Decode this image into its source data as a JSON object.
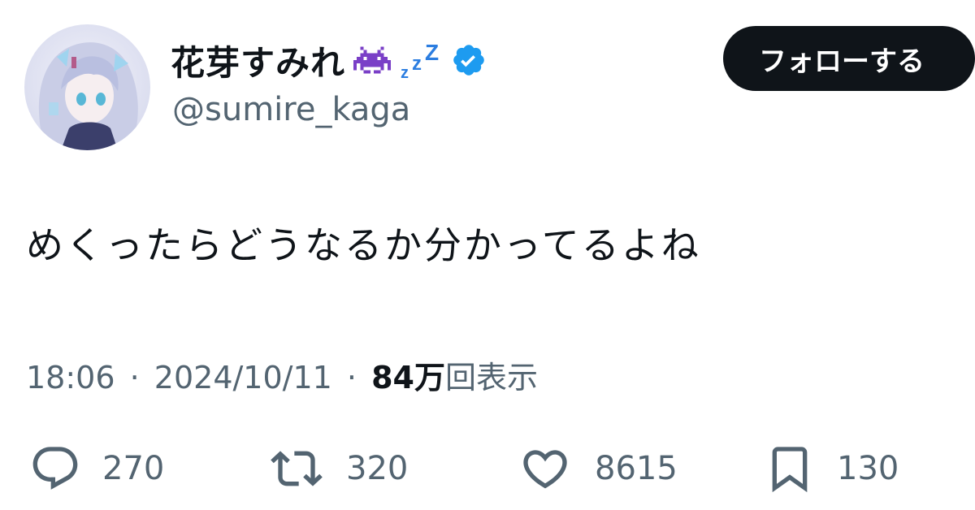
{
  "author": {
    "display_name": "花芽すみれ",
    "handle": "@sumire_kaga",
    "verified": true,
    "name_emoji": [
      "purple-space-invader-icon",
      "zzz-sleep-icon"
    ],
    "verified_color": "#1d9bf0"
  },
  "follow_button": {
    "label": "フォローする"
  },
  "tweet": {
    "text": "めくったらどうなるか分かってるよね"
  },
  "meta": {
    "time": "18:06",
    "separator": "·",
    "date": "2024/10/11",
    "views_count": "84万",
    "views_label": "回表示"
  },
  "actions": {
    "replies": "270",
    "retweets": "320",
    "likes": "8615",
    "bookmarks": "130"
  },
  "colors": {
    "text_primary": "#0f1419",
    "text_secondary": "#536471",
    "button_bg": "#0f1419",
    "verified": "#1d9bf0",
    "emoji_purple": "#7a3fc7",
    "zzz": "#2b7de0"
  }
}
